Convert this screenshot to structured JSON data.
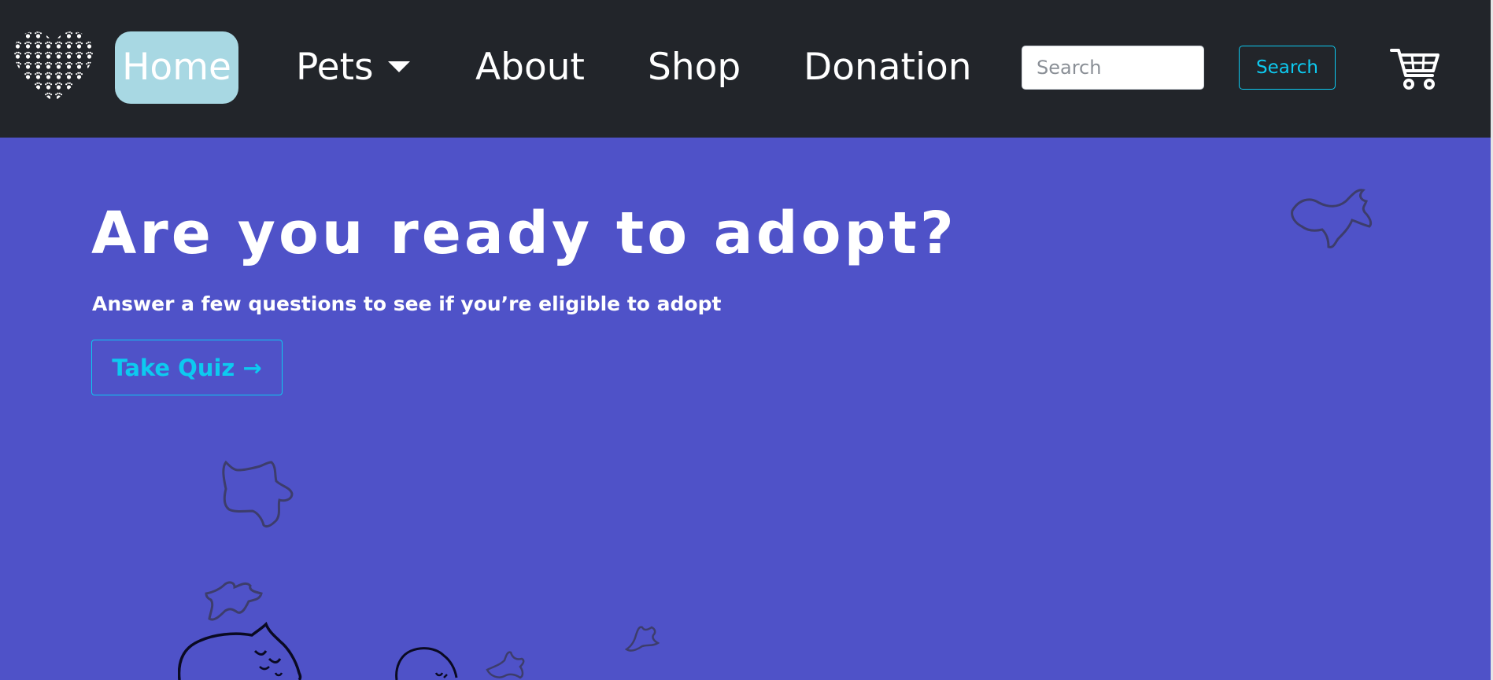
{
  "nav": {
    "logo_icon": "paw-heart-logo-icon",
    "items": [
      {
        "label": "Home",
        "active": true
      },
      {
        "label": "Pets",
        "dropdown": true
      },
      {
        "label": "About"
      },
      {
        "label": "Shop"
      },
      {
        "label": "Donation"
      }
    ],
    "search": {
      "placeholder": "Search",
      "value": "",
      "button_label": "Search"
    },
    "cart_icon": "shopping-cart-icon"
  },
  "hero": {
    "title": "Are you ready to adopt?",
    "subtitle": "Answer a few questions to see if you’re eligible to adopt",
    "quiz_button_label": "Take Quiz →"
  },
  "colors": {
    "navbar_bg": "#22252a",
    "hero_bg": "#4f52c8",
    "active_nav_bg": "#a8d8e3",
    "accent": "#0dcaf0",
    "text": "#ffffff"
  },
  "decorations": [
    "dog-outline-icon",
    "cat-outline-icon",
    "sleeping-cat-icon",
    "star-icon"
  ]
}
